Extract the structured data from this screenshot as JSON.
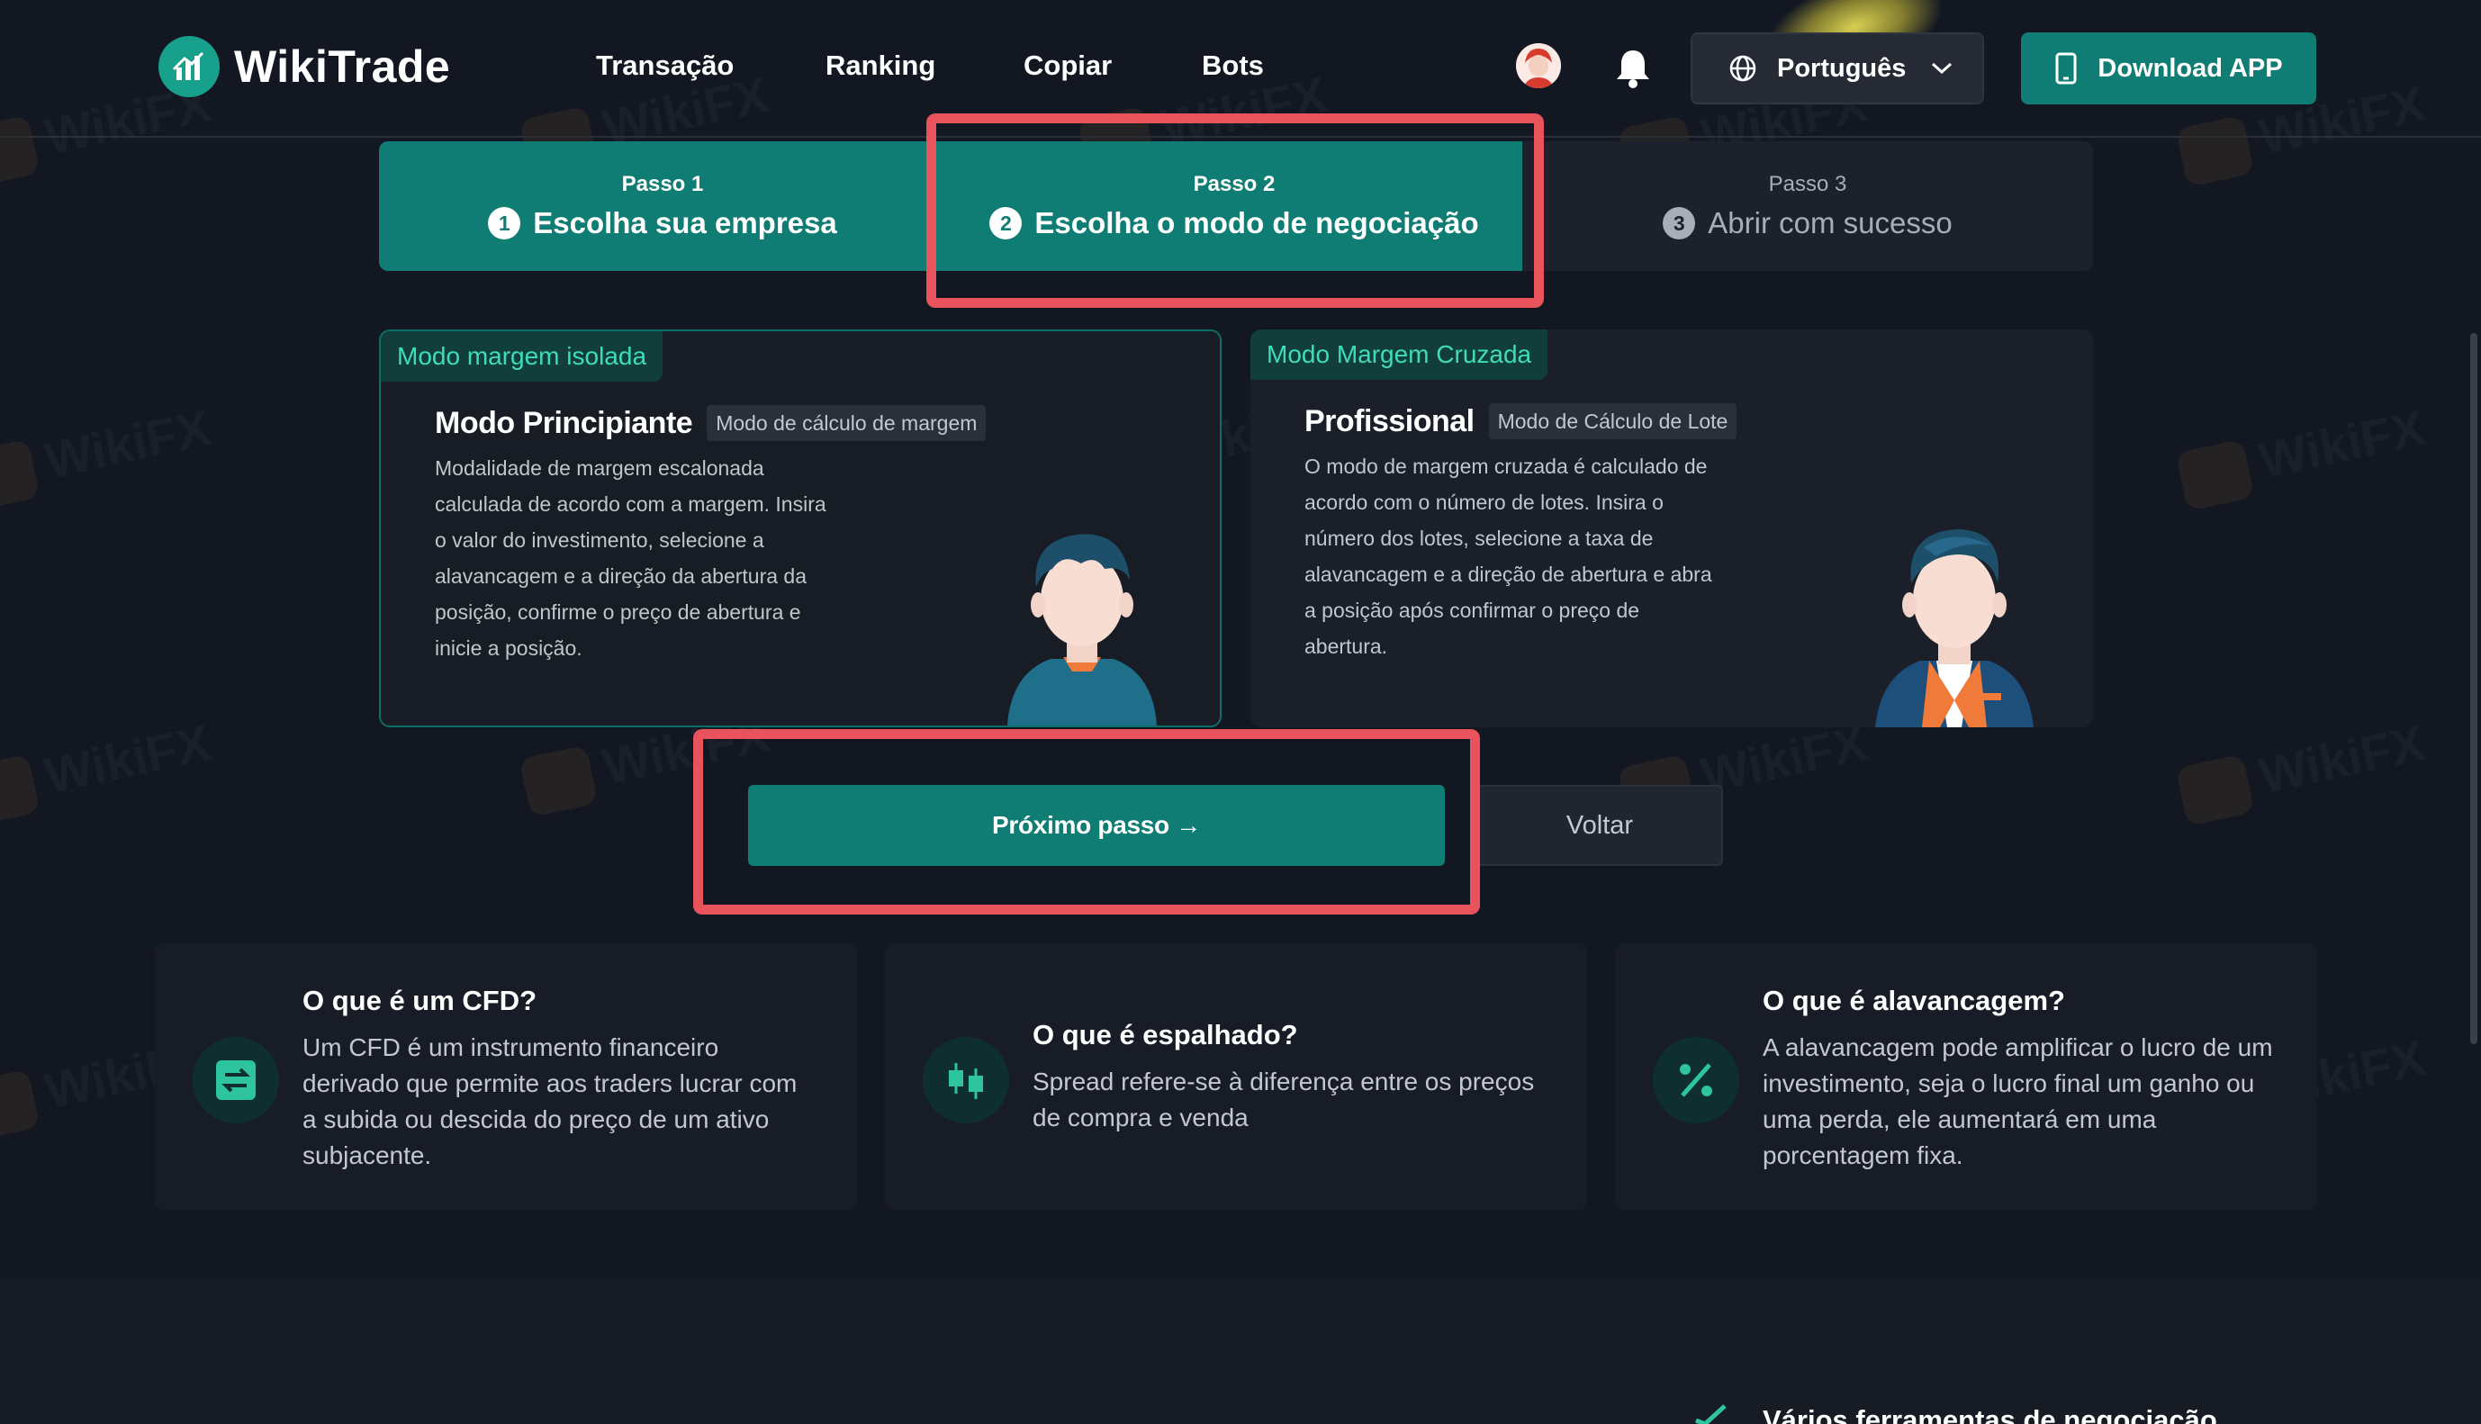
{
  "header": {
    "brand": "WikiTrade",
    "nav": [
      "Transação",
      "Ranking",
      "Copiar",
      "Bots"
    ],
    "language": "Português",
    "download_label": "Download APP"
  },
  "steps": [
    {
      "label": "Passo 1",
      "number": "1",
      "title": "Escolha sua empresa",
      "state": "done"
    },
    {
      "label": "Passo 2",
      "number": "2",
      "title": "Escolha o modo de negociação",
      "state": "current"
    },
    {
      "label": "Passo 3",
      "number": "3",
      "title": "Abrir com sucesso",
      "state": "todo"
    }
  ],
  "modes": [
    {
      "tag": "Modo margem isolada",
      "title": "Modo Principiante",
      "chip": "Modo de cálculo de margem",
      "description_lines": [
        "Modalidade de margem escalonada",
        "calculada de acordo com a margem. Insira",
        "o valor do investimento, selecione a",
        "alavancagem e a direção da abertura da",
        "posição, confirme o preço de abertura e",
        "inicie a posição."
      ],
      "selected": true
    },
    {
      "tag": "Modo Margem Cruzada",
      "title": "Profissional",
      "chip": "Modo de Cálculo de Lote",
      "description_lines": [
        "O modo de margem cruzada é calculado de",
        "acordo com o número de lotes. Insira o",
        "número dos lotes, selecione a taxa de",
        "alavancagem e a direção de abertura e abra",
        "a posição após confirmar o preço de",
        "abertura."
      ],
      "selected": false
    }
  ],
  "actions": {
    "next_label": "Próximo passo →",
    "back_label": "Voltar"
  },
  "info_cards": [
    {
      "icon": "exchange-icon",
      "title": "O que é um CFD?",
      "lines": [
        "Um CFD é um instrumento financeiro",
        "derivado que permite aos traders lucrar com",
        "a subida ou descida do preço de um ativo",
        "subjacente."
      ]
    },
    {
      "icon": "candlestick-icon",
      "title": "O que é espalhado?",
      "lines": [
        "Spread refere-se à diferença entre os preços",
        "de compra e venda"
      ]
    },
    {
      "icon": "percent-icon",
      "title": "O que é alavancagem?",
      "lines": [
        "A alavancagem pode amplificar o lucro de um",
        "investimento, seja o lucro final um ganho ou",
        "uma perda, ele aumentará em uma",
        "porcentagem fixa."
      ]
    }
  ],
  "bottom_section_title": "Vários ferramentas de negociação",
  "colors": {
    "background": "#131722",
    "accent": "#0f7d74",
    "tag_text": "#3fdcb9",
    "highlight": "#e9545c"
  },
  "watermark_text": "WikiFX"
}
